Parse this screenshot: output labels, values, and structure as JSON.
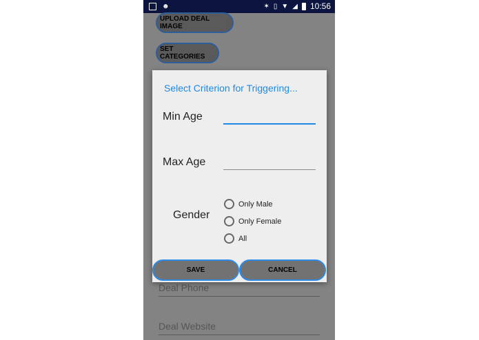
{
  "status_bar": {
    "time": "10:56",
    "left_icons": [
      "notification-square-icon",
      "app-notification-icon"
    ],
    "right_icons": [
      "bluetooth-icon",
      "vibrate-icon",
      "wifi-icon",
      "signal-icon",
      "battery-icon"
    ]
  },
  "background": {
    "upload_button_label": "UPLOAD DEAL IMAGE",
    "categories_button_label": "SET CATEGORIES",
    "deal_phone_label": "Deal Phone",
    "deal_website_label": "Deal Website"
  },
  "dialog": {
    "title": "Select Criterion for Triggering...",
    "min_age_label": "Min Age",
    "min_age_value": "",
    "max_age_label": "Max Age",
    "max_age_value": "",
    "gender_label": "Gender",
    "gender_options": [
      "Only Male",
      "Only Female",
      "All"
    ],
    "save_label": "SAVE",
    "cancel_label": "CANCEL"
  },
  "colors": {
    "accent": "#1e88e5",
    "status_bar": "#0b1540",
    "dialog_bg": "#eeeeee",
    "scrim": "#838383"
  }
}
